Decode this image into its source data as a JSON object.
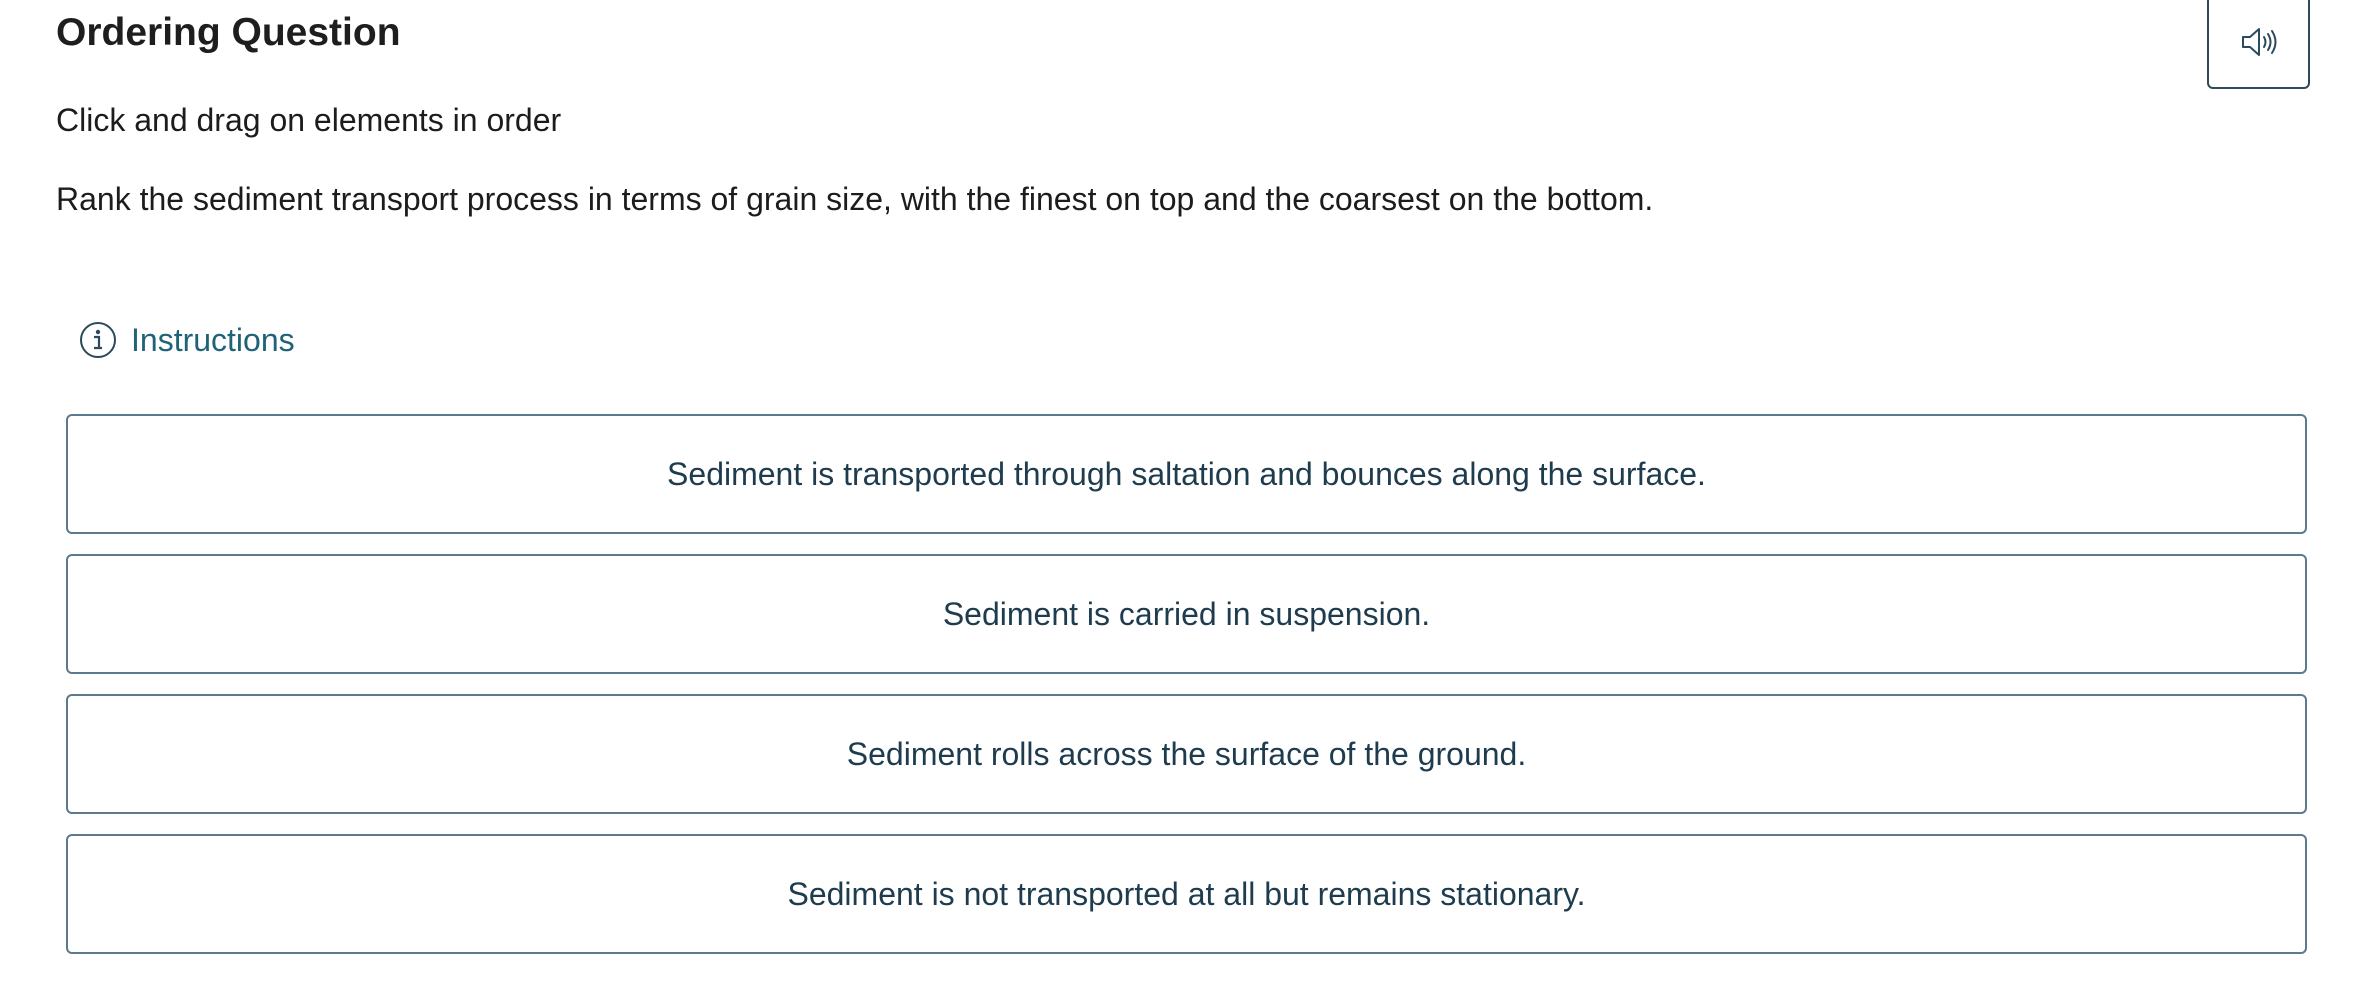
{
  "header": {
    "title": "Ordering Question",
    "audio_icon": "speaker-icon"
  },
  "question": {
    "directions": "Click and drag on elements in order",
    "prompt": "Rank the sediment transport process in terms of grain size, with the finest on top and the coarsest on the bottom."
  },
  "instructions": {
    "icon": "info-icon",
    "label": "Instructions"
  },
  "items": [
    {
      "text": "Sediment is transported through saltation and bounces along the surface."
    },
    {
      "text": "Sediment is carried in suspension."
    },
    {
      "text": "Sediment rolls across the surface of the ground."
    },
    {
      "text": "Sediment is not transported at all but remains stationary."
    }
  ],
  "colors": {
    "accent": "#1f6378",
    "border": "#5b7a8c",
    "item_text": "#1e3c4e"
  }
}
